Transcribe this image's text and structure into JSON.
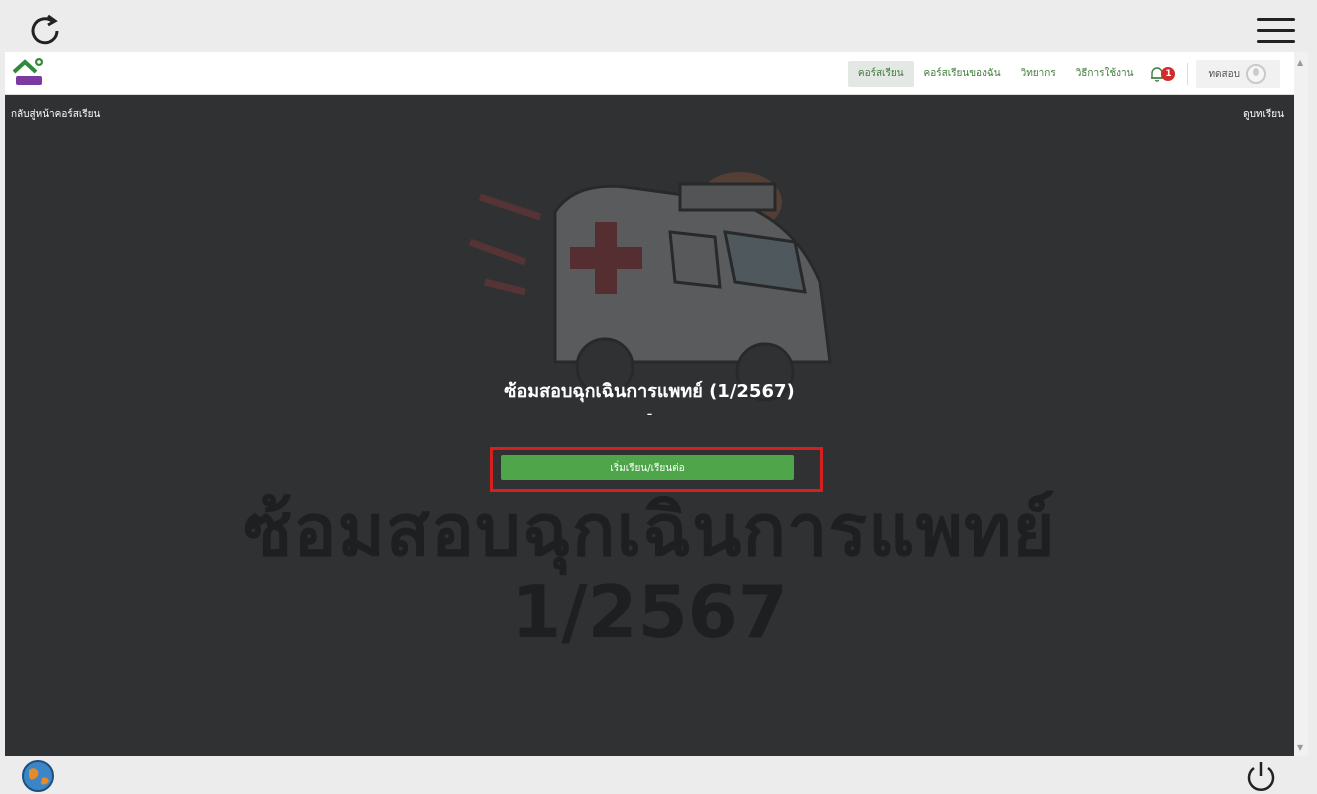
{
  "nav": {
    "courses": "คอร์สเรียน",
    "my_courses": "คอร์สเรียนของฉัน",
    "instructors": "วิทยากร",
    "how_to": "วิธีการใช้งาน",
    "notification_count": "1",
    "user_name": "ทดสอบ"
  },
  "page": {
    "back_link": "กลับสู่หน้าคอร์สเรียน",
    "document_link": "ดูบทเรียน",
    "course_title": "ซ้อมสอบฉุกเฉินการแพทย์ (1/2567)",
    "course_description": "-",
    "start_button": "เริ่มเรียน/เรียนต่อ",
    "watermark_line1": "ซ้อมสอบฉุกเฉินการแพทย์",
    "watermark_line2": "1/2567"
  },
  "colors": {
    "accent_green": "#4fa54a",
    "highlight_red": "#d61f1f",
    "content_bg": "#2f3133"
  },
  "icons": [
    "refresh-icon",
    "menu-icon",
    "bell-icon",
    "avatar-icon",
    "globe-icon",
    "power-icon"
  ]
}
